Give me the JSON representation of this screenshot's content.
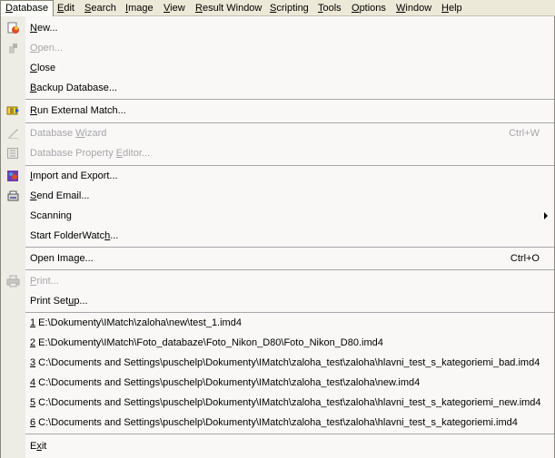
{
  "menubar": [
    {
      "label": "Database",
      "u": "D",
      "rest": "atabase"
    },
    {
      "label": "Edit",
      "u": "E",
      "rest": "dit"
    },
    {
      "label": "Search",
      "u": "S",
      "rest": "earch"
    },
    {
      "label": "Image",
      "u": "I",
      "rest": "mage"
    },
    {
      "label": "View",
      "u": "V",
      "rest": "iew"
    },
    {
      "label": "Result Window",
      "u": "R",
      "rest": "esult Window"
    },
    {
      "label": "Scripting",
      "u": "S",
      "rest": "cripting"
    },
    {
      "label": "Tools",
      "u": "T",
      "rest": "ools"
    },
    {
      "label": "Options",
      "u": "O",
      "rest": "ptions"
    },
    {
      "label": "Window",
      "u": "W",
      "rest": "indow"
    },
    {
      "label": "Help",
      "u": "H",
      "rest": "elp"
    }
  ],
  "menu": {
    "new": {
      "u": "N",
      "rest": "ew..."
    },
    "open": {
      "u": "O",
      "rest": "pen..."
    },
    "close": {
      "u": "C",
      "rest": "lose"
    },
    "backup": {
      "u": "B",
      "rest": "ackup Database..."
    },
    "run_external": {
      "u": "R",
      "rest": "un External Match..."
    },
    "wizard": {
      "pre": "Database ",
      "u": "W",
      "rest": "izard",
      "shortcut": "Ctrl+W"
    },
    "property_editor": {
      "pre": "Database Property ",
      "u": "E",
      "rest": "ditor..."
    },
    "import_export": {
      "u": "I",
      "rest": "mport and Export..."
    },
    "send_email": {
      "u": "S",
      "rest": "end Email..."
    },
    "scanning": {
      "label": "Scanning"
    },
    "folderwatch": {
      "pre": "Start FolderWatc",
      "u": "h",
      "rest": "..."
    },
    "open_image": {
      "pre": "Open Ima",
      "u": "g",
      "rest": "e...",
      "shortcut": "Ctrl+O"
    },
    "print": {
      "u": "P",
      "rest": "rint..."
    },
    "print_setup": {
      "pre": "Print Set",
      "u": "u",
      "rest": "p..."
    },
    "recent": [
      {
        "num": "1",
        "path": " E:\\Dokumenty\\IMatch\\zaloha\\new\\test_1.imd4"
      },
      {
        "num": "2",
        "path": " E:\\Dokumenty\\IMatch\\Foto_databaze\\Foto_Nikon_D80\\Foto_Nikon_D80.imd4"
      },
      {
        "num": "3",
        "path": " C:\\Documents and Settings\\puschelp\\Dokumenty\\IMatch\\zaloha_test\\zaloha\\hlavni_test_s_kategoriemi_bad.imd4"
      },
      {
        "num": "4",
        "path": " C:\\Documents and Settings\\puschelp\\Dokumenty\\IMatch\\zaloha_test\\zaloha\\new.imd4"
      },
      {
        "num": "5",
        "path": " C:\\Documents and Settings\\puschelp\\Dokumenty\\IMatch\\zaloha_test\\zaloha\\hlavni_test_s_kategoriemi_new.imd4"
      },
      {
        "num": "6",
        "path": " C:\\Documents and Settings\\puschelp\\Dokumenty\\IMatch\\zaloha_test\\zaloha\\hlavni_test_s_kategoriemi.imd4"
      }
    ],
    "exit": {
      "pre": "E",
      "u": "x",
      "rest": "it"
    }
  },
  "colors": {
    "gutter": "#eeede5",
    "menu_bg": "#f9f8f7",
    "disabled": "#a7a6aa",
    "menubar": "#ece9d8"
  }
}
